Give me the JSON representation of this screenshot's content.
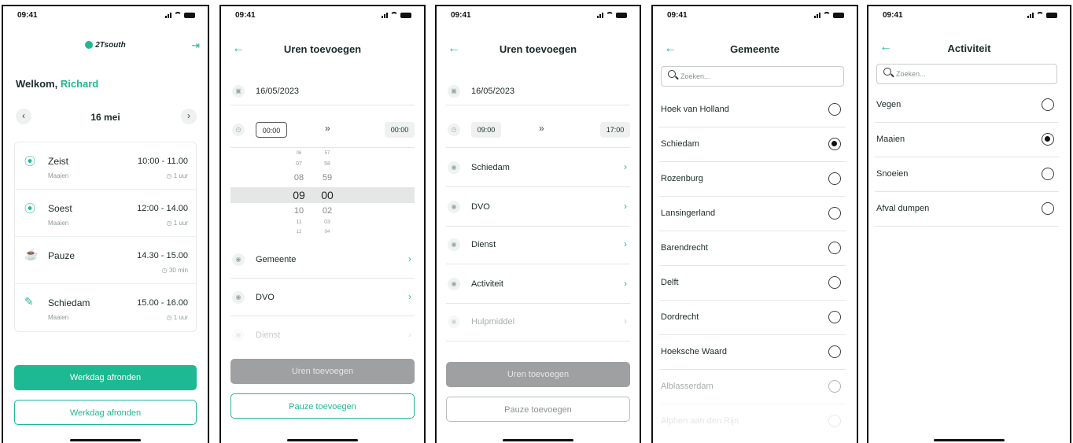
{
  "status_time": "09:41",
  "screen1": {
    "brand": "2Tsouth",
    "welcome_prefix": "Welkom,",
    "user_name": "Richard",
    "date": "16 mei",
    "entries": [
      {
        "place": "Zeist",
        "activity": "Maaien",
        "time": "10:00 - 11.00",
        "duration": "1 uur",
        "icon": "location-pin-icon"
      },
      {
        "place": "Soest",
        "activity": "Maaien",
        "time": "12:00 - 14.00",
        "duration": "1 uur",
        "icon": "location-pin-icon"
      },
      {
        "place": "Pauze",
        "activity": "",
        "time": "14.30 - 15.00",
        "duration": "30 min",
        "icon": "coffee-cup-icon"
      },
      {
        "place": "Schiedam",
        "activity": "Maaien",
        "time": "15.00 - 16.00",
        "duration": "1 uur",
        "icon": "pencil-icon"
      }
    ],
    "primary_button": "Werkdag afronden",
    "secondary_button": "Werkdag afronden"
  },
  "screen2": {
    "title": "Uren toevoegen",
    "date": "16/05/2023",
    "start_time": "00:00",
    "end_time": "00:00",
    "picker_hours": [
      "06",
      "07",
      "08",
      "09",
      "10",
      "11",
      "12"
    ],
    "picker_minutes": [
      "57",
      "58",
      "59",
      "00",
      "02",
      "03",
      "04"
    ],
    "rows": [
      "Gemeente",
      "DVO",
      "Dienst"
    ],
    "primary_button": "Uren toevoegen",
    "secondary_button": "Pauze toevoegen"
  },
  "screen3": {
    "title": "Uren toevoegen",
    "date": "16/05/2023",
    "start_time": "09:00",
    "end_time": "17:00",
    "rows": [
      "Schiedam",
      "DVO",
      "Dienst",
      "Activiteit",
      "Hulpmiddel"
    ],
    "primary_button": "Uren toevoegen",
    "secondary_button": "Pauze toevoegen"
  },
  "screen4": {
    "title": "Gemeente",
    "search_placeholder": "Zoeken...",
    "options": [
      "Hoek van Holland",
      "Schiedam",
      "Rozenburg",
      "Lansingerland",
      "Barendrecht",
      "Delft",
      "Dordrecht",
      "Hoeksche Waard",
      "Alblasserdam",
      "Alphen aan den Rijn"
    ],
    "selected_index": 1
  },
  "screen5": {
    "title": "Activiteit",
    "search_placeholder": "Zoeken...",
    "options": [
      "Vegen",
      "Maaien",
      "Snoeien",
      "Afval dumpen"
    ],
    "selected_index": 1
  },
  "colors": {
    "accent": "#1db992",
    "disabled_button": "#9ea0a1"
  }
}
